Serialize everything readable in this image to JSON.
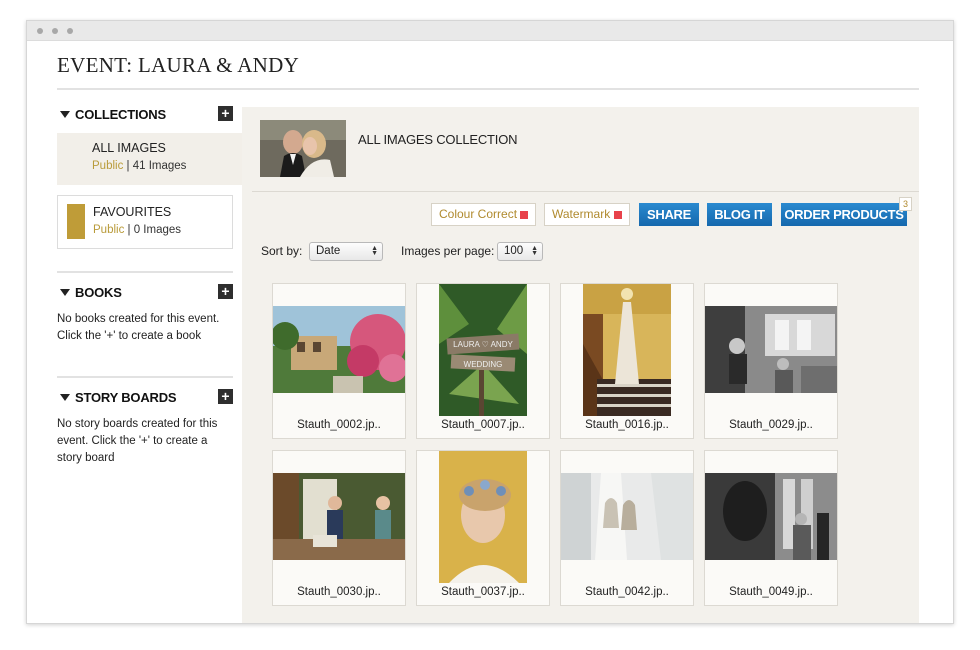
{
  "page": {
    "title": "EVENT: LAURA & ANDY"
  },
  "sidebar": {
    "collections_label": "COLLECTIONS",
    "all_images": {
      "name": "ALL IMAGES",
      "visibility": "Public",
      "count": "41 Images"
    },
    "favourites": {
      "name": "FAVOURITES",
      "visibility": "Public",
      "count": "0 Images",
      "color": "#bf9c38"
    },
    "books_label": "BOOKS",
    "books_empty": "No books created for this event. Click the '+' to create a book",
    "storyboards_label": "STORY BOARDS",
    "storyboards_empty": "No story boards created for this event. Click the '+' to create a story board",
    "add_icon": "+"
  },
  "main": {
    "collection_title": "ALL IMAGES COLLECTION",
    "buttons": {
      "colour_correct": "Colour Correct",
      "watermark": "Watermark",
      "share": "SHARE",
      "blog_it": "BLOG IT",
      "order_products": "ORDER PRODUCTS",
      "order_badge": "3"
    },
    "sort_by_label": "Sort by:",
    "sort_by_value": "Date",
    "per_page_label": "Images per page:",
    "per_page_value": "100",
    "images": [
      {
        "filename": "Stauth_0002.jp..",
        "kind": "garden-flowers"
      },
      {
        "filename": "Stauth_0007.jp..",
        "kind": "wedding-sign"
      },
      {
        "filename": "Stauth_0016.jp..",
        "kind": "dress-staircase"
      },
      {
        "filename": "Stauth_0029.jp..",
        "kind": "bw-room"
      },
      {
        "filename": "Stauth_0030.jp..",
        "kind": "bridesmaids-room"
      },
      {
        "filename": "Stauth_0037.jp..",
        "kind": "bride-hair"
      },
      {
        "filename": "Stauth_0042.jp..",
        "kind": "shoes-dress"
      },
      {
        "filename": "Stauth_0049.jp..",
        "kind": "bw-window"
      }
    ]
  },
  "colors": {
    "accent_gold": "#b99b3a",
    "button_blue": "#1b73b8",
    "marker_red": "#e8424b",
    "panel_bg": "#f3f1ec"
  }
}
